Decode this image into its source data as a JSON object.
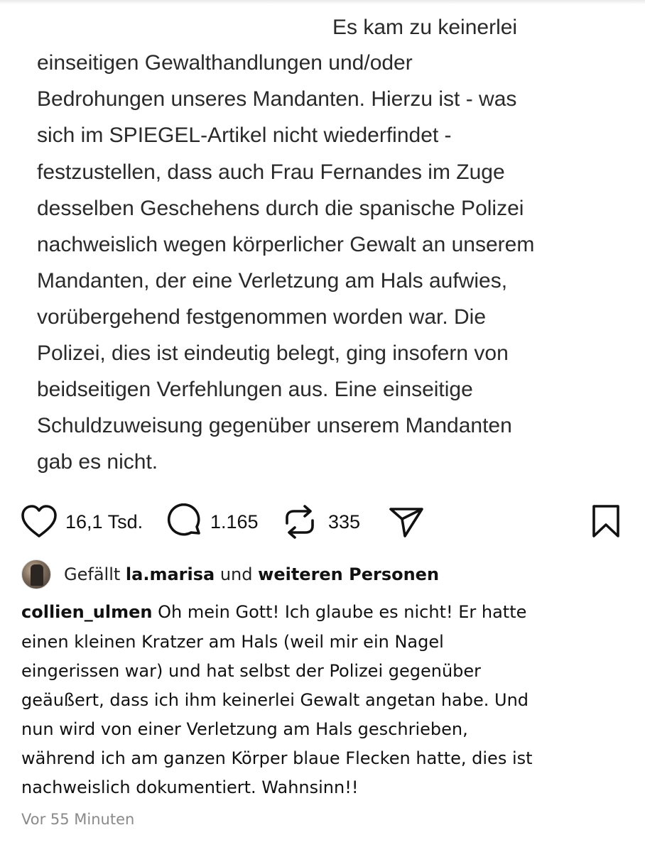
{
  "post": {
    "quote_lines": [
      "Es kam zu keinerlei",
      "einseitigen Gewalthandlungen und/oder",
      "Bedrohungen unseres Mandanten. Hierzu ist - was",
      "sich im SPIEGEL-Artikel nicht wiederfindet -",
      "festzustellen, dass auch Frau Fernandes im Zuge",
      "desselben Geschehens durch die spanische Polizei",
      "nachweislich wegen körperlicher Gewalt an unserem",
      "Mandanten, der eine Verletzung am Hals aufwies,",
      "vorübergehend festgenommen worden war. Die",
      "Polizei, dies ist eindeutig belegt, ging insofern von",
      "beidseitigen Verfehlungen aus. Eine einseitige",
      "Schuldzuweisung gegenüber unserem Mandanten",
      "gab es nicht."
    ]
  },
  "actions": {
    "likes": "16,1 Tsd.",
    "comments": "1.165",
    "reposts": "335",
    "icons": [
      "heart-icon",
      "comment-bubble-icon",
      "repost-icon",
      "send-icon",
      "bookmark-icon"
    ]
  },
  "liked_by": {
    "prefix": "Gefällt",
    "user": "la.marisa",
    "middle": "und",
    "others": "weiteren Personen"
  },
  "caption": {
    "username": "collien_ulmen",
    "first_line_text": " Oh mein Gott! Ich glaube es nicht! Er hatte",
    "lines": [
      "einen kleinen Kratzer am Hals (weil mir ein Nagel",
      "eingerissen war) und hat selbst der Polizei gegenüber",
      "geäußert, dass ich ihm keinerlei Gewalt angetan habe. Und",
      "nun wird von einer Verletzung am Hals geschrieben,",
      "während ich am ganzen Körper blaue Flecken hatte, dies ist",
      "nachweislich dokumentiert. Wahnsinn!!"
    ]
  },
  "timestamp": "Vor 55 Minuten"
}
